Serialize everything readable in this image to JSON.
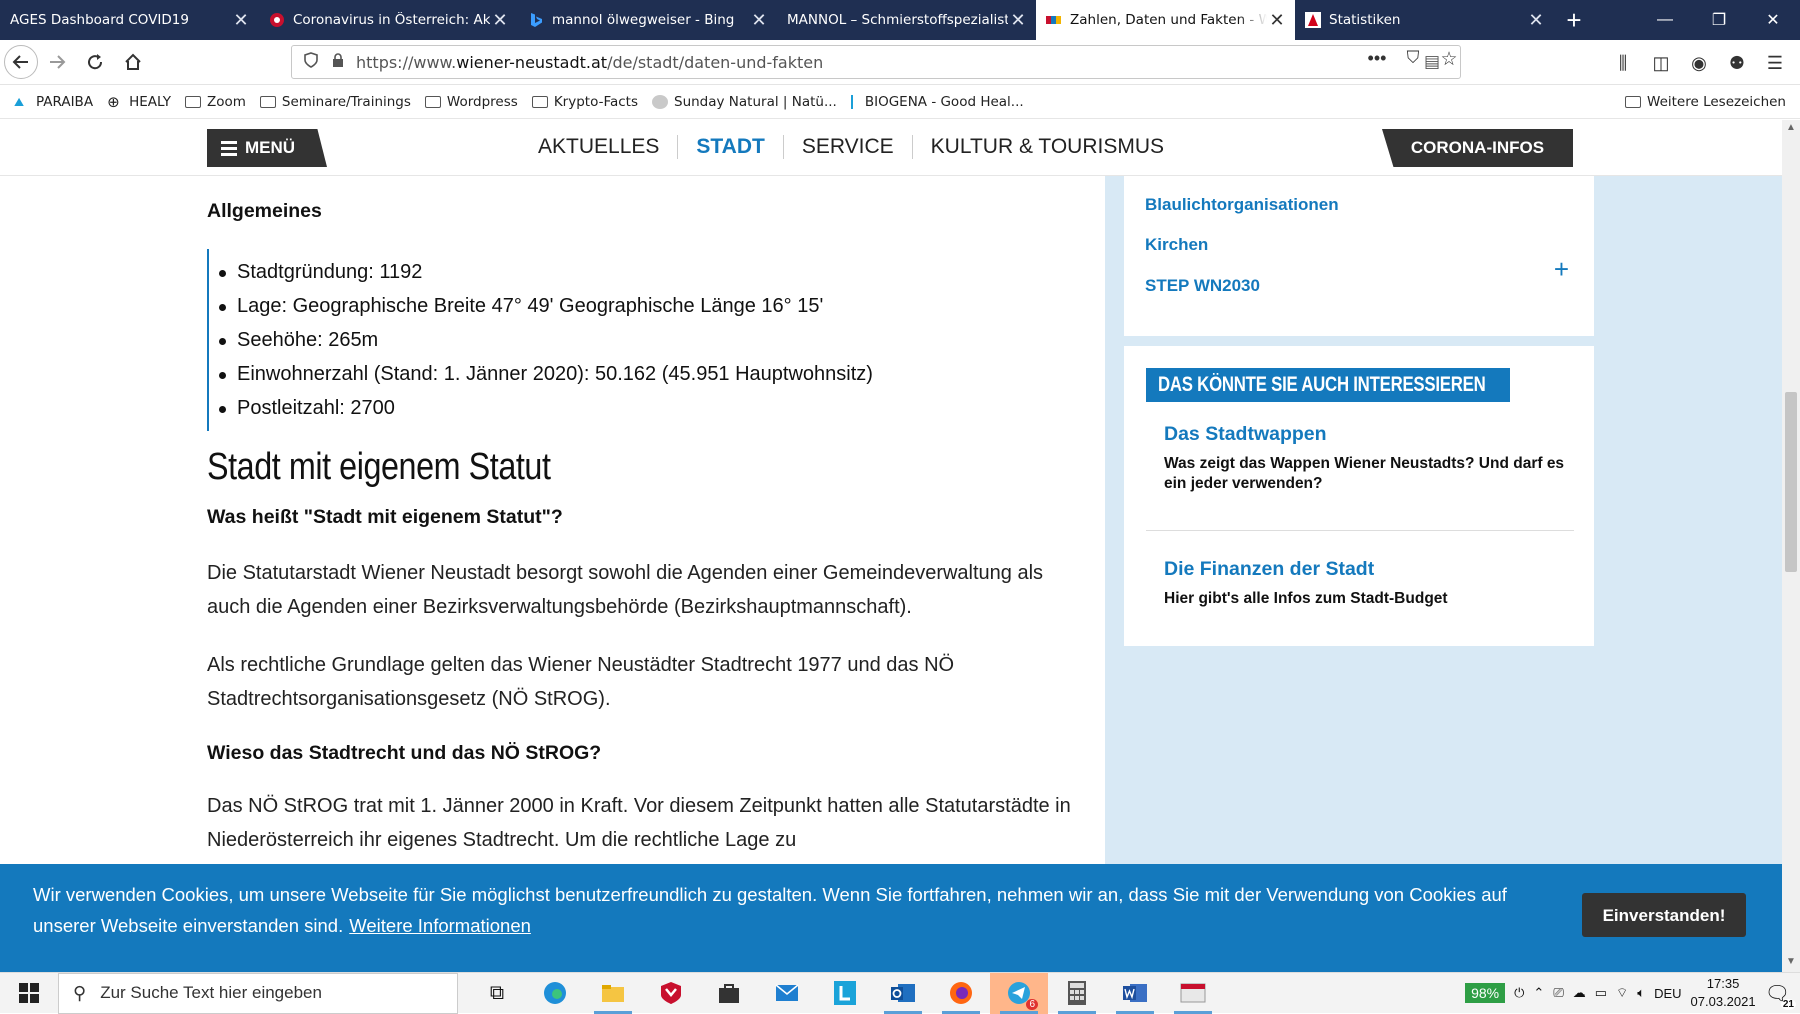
{
  "browser": {
    "tabs": [
      {
        "title": "AGES Dashboard COVID19",
        "favicon": "none",
        "active": false
      },
      {
        "title": "Coronavirus in Österreich: Aktu",
        "favicon": "red-circle-icon",
        "active": false
      },
      {
        "title": "mannol ölwegweiser - Bing",
        "favicon": "bing-icon",
        "active": false
      },
      {
        "title": "MANNOL – Schmierstoffspezialist",
        "favicon": "none",
        "active": false
      },
      {
        "title": "Zahlen, Daten und Fakten - Wi",
        "favicon": "wn-logo-icon",
        "active": true
      },
      {
        "title": "Statistiken",
        "favicon": "red-logo-icon",
        "active": false
      }
    ],
    "url_prefix": "https://www.",
    "url_domain": "wiener-neustadt.at",
    "url_path": "/de/stadt/daten-und-fakten",
    "bookmarks": [
      {
        "label": "PARAIBA",
        "icon": "paraiba-icon"
      },
      {
        "label": "HEALY",
        "icon": "globe-icon"
      },
      {
        "label": "Zoom",
        "icon": "folder-icon"
      },
      {
        "label": "Seminare/Trainings",
        "icon": "folder-icon"
      },
      {
        "label": "Wordpress",
        "icon": "folder-icon"
      },
      {
        "label": "Krypto-Facts",
        "icon": "folder-icon"
      },
      {
        "label": "Sunday Natural | Natü...",
        "icon": "sunday-icon"
      },
      {
        "label": "BIOGENA - Good Heal...",
        "icon": "biogena-icon"
      }
    ],
    "bookmarks_other": "Weitere Lesezeichen"
  },
  "site": {
    "menu_label": "MENÜ",
    "nav": [
      "AKTUELLES",
      "STADT",
      "SERVICE",
      "KULTUR & TOURISMUS"
    ],
    "nav_active": "STADT",
    "corona_label": "CORONA-INFOS",
    "accent_color": "#1479bd"
  },
  "content": {
    "section_general": "Allgemeines",
    "facts": [
      "Stadtgründung: 1192",
      "Lage: Geographische Breite 47° 49' Geographische Länge 16° 15'",
      "Seehöhe: 265m",
      "Einwohnerzahl (Stand: 1. Jänner 2020): 50.162 (45.951 Hauptwohnsitz)",
      "Postleitzahl: 2700"
    ],
    "heading_statut": "Stadt mit eigenem Statut",
    "question1": "Was heißt \"Stadt mit eigenem Statut\"?",
    "para1": "Die Statutarstadt Wiener Neustadt besorgt sowohl die Agenden einer Gemeindeverwaltung als auch die Agenden einer Bezirksverwaltungsbehörde (Bezirkshauptmannschaft).",
    "para2": "Als rechtliche Grundlage gelten das Wiener Neustädter Stadtrecht 1977 und das NÖ Stadtrechtsorganisationsgesetz (NÖ StROG).",
    "question2": "Wieso das Stadtrecht und das NÖ StROG?",
    "para3": "Das NÖ StROG trat mit 1. Jänner 2000 in Kraft. Vor diesem Zeitpunkt hatten alle Statutarstädte in Niederösterreich ihr eigenes Stadtrecht. Um die rechtliche Lage zu"
  },
  "sidebar": {
    "links": [
      "Blaulichtorganisationen",
      "Kirchen",
      "STEP WN2030"
    ],
    "interest_heading": "DAS KÖNNTE SIE AUCH INTERESSIEREN",
    "articles": [
      {
        "title": "Das Stadtwappen",
        "desc": "Was zeigt das Wappen Wiener Neustadts? Und darf es ein jeder verwenden?"
      },
      {
        "title": "Die Finanzen der Stadt",
        "desc": "Hier gibt's alle Infos zum Stadt-Budget"
      }
    ]
  },
  "cookie": {
    "text": "Wir verwenden Cookies, um unsere Webseite für Sie möglichst benutzerfreundlich zu gestalten. Wenn Sie fortfahren, nehmen wir an, dass Sie mit der Verwendung von Cookies auf unserer Webseite einverstanden sind.",
    "link": "Weitere Informationen",
    "button": "Einverstanden!"
  },
  "taskbar": {
    "search_placeholder": "Zur Suche Text hier eingeben",
    "battery": "98%",
    "language": "DEU",
    "time": "17:35",
    "date": "07.03.2021",
    "notifications": "21",
    "telegram_badge": "6"
  }
}
